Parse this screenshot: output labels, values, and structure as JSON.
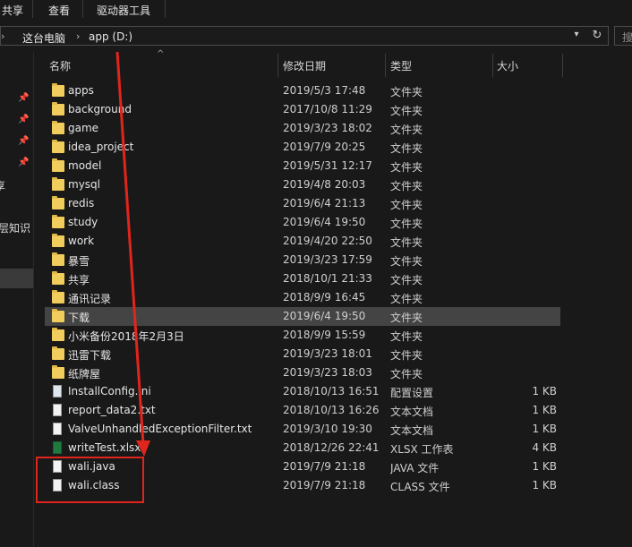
{
  "ribbon": {
    "tabs": [
      "共享",
      "查看",
      "驱动器工具"
    ]
  },
  "address": {
    "crumbs": [
      "这台电脑",
      "app (D:)"
    ],
    "search_placeholder": "搜"
  },
  "nav": {
    "labels": [
      "享",
      "层知识"
    ]
  },
  "columns": {
    "name": "名称",
    "date": "修改日期",
    "type": "类型",
    "size": "大小"
  },
  "files": [
    {
      "name": "apps",
      "date": "2019/5/3 17:48",
      "type": "文件夹",
      "size": "",
      "icon": "folder-icon"
    },
    {
      "name": "background",
      "date": "2017/10/8 11:29",
      "type": "文件夹",
      "size": "",
      "icon": "folder-icon"
    },
    {
      "name": "game",
      "date": "2019/3/23 18:02",
      "type": "文件夹",
      "size": "",
      "icon": "folder-icon"
    },
    {
      "name": "idea_project",
      "date": "2019/7/9 20:25",
      "type": "文件夹",
      "size": "",
      "icon": "folder-icon"
    },
    {
      "name": "model",
      "date": "2019/5/31 12:17",
      "type": "文件夹",
      "size": "",
      "icon": "folder-icon"
    },
    {
      "name": "mysql",
      "date": "2019/4/8 20:03",
      "type": "文件夹",
      "size": "",
      "icon": "folder-icon"
    },
    {
      "name": "redis",
      "date": "2019/6/4 21:13",
      "type": "文件夹",
      "size": "",
      "icon": "folder-icon"
    },
    {
      "name": "study",
      "date": "2019/6/4 19:50",
      "type": "文件夹",
      "size": "",
      "icon": "folder-icon"
    },
    {
      "name": "work",
      "date": "2019/4/20 22:50",
      "type": "文件夹",
      "size": "",
      "icon": "folder-icon"
    },
    {
      "name": "暴雪",
      "date": "2019/3/23 17:59",
      "type": "文件夹",
      "size": "",
      "icon": "folder-icon"
    },
    {
      "name": "共享",
      "date": "2018/10/1 21:33",
      "type": "文件夹",
      "size": "",
      "icon": "folder-icon"
    },
    {
      "name": "通讯记录",
      "date": "2018/9/9 16:45",
      "type": "文件夹",
      "size": "",
      "icon": "folder-icon"
    },
    {
      "name": "下载",
      "date": "2019/6/4 19:50",
      "type": "文件夹",
      "size": "",
      "icon": "folder-icon"
    },
    {
      "name": "小米备份2018年2月3日",
      "date": "2018/9/9 15:59",
      "type": "文件夹",
      "size": "",
      "icon": "folder-icon"
    },
    {
      "name": "迅雷下载",
      "date": "2019/3/23 18:01",
      "type": "文件夹",
      "size": "",
      "icon": "folder-icon"
    },
    {
      "name": "纸牌屋",
      "date": "2019/3/23 18:03",
      "type": "文件夹",
      "size": "",
      "icon": "folder-icon"
    },
    {
      "name": "InstallConfig.ini",
      "date": "2018/10/13 16:51",
      "type": "配置设置",
      "size": "1 KB",
      "icon": "config-file-icon"
    },
    {
      "name": "report_data2.txt",
      "date": "2018/10/13 16:26",
      "type": "文本文档",
      "size": "1 KB",
      "icon": "text-file-icon"
    },
    {
      "name": "ValveUnhandledExceptionFilter.txt",
      "date": "2019/3/10 19:30",
      "type": "文本文档",
      "size": "1 KB",
      "icon": "text-file-icon"
    },
    {
      "name": "writeTest.xlsx",
      "date": "2018/12/26 22:41",
      "type": "XLSX 工作表",
      "size": "4 KB",
      "icon": "excel-file-icon"
    },
    {
      "name": "wali.java",
      "date": "2019/7/9 21:18",
      "type": "JAVA 文件",
      "size": "1 KB",
      "icon": "file-icon"
    },
    {
      "name": "wali.class",
      "date": "2019/7/9 21:18",
      "type": "CLASS 文件",
      "size": "1 KB",
      "icon": "file-icon"
    }
  ],
  "selected_row": 12,
  "colors": {
    "background": "#191919",
    "selection": "#444444",
    "folder": "#f0cd5c",
    "annotation": "#e0251c"
  }
}
